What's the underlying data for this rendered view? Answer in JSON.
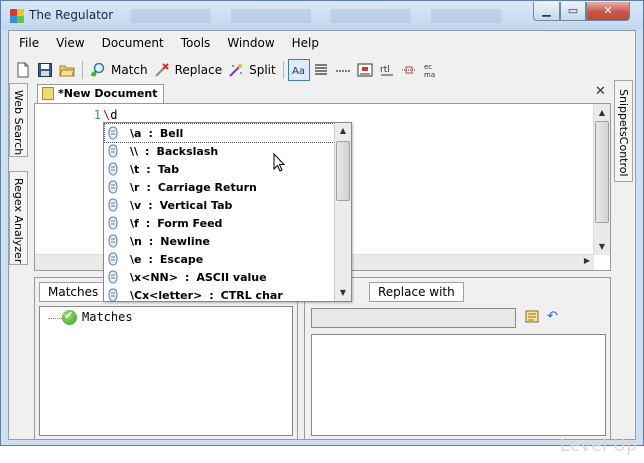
{
  "window": {
    "title": "The Regulator",
    "min": "▁",
    "max": "▭",
    "close": "✕"
  },
  "menu": [
    "File",
    "View",
    "Document",
    "Tools",
    "Window",
    "Help"
  ],
  "toolbar": {
    "match": "Match",
    "replace": "Replace",
    "split": "Split"
  },
  "left_tabs": {
    "web_search": "Web Search",
    "regex_analyzer": "Regex Analyzer"
  },
  "right_tab": "SnippetsControl",
  "document": {
    "tab_label": "*New Document",
    "line_number": "1",
    "code_bs": "\\",
    "code_rest": "d"
  },
  "autocomplete": [
    {
      "code": "\\a",
      "desc": "Bell"
    },
    {
      "code": "\\\\",
      "desc": "Backslash"
    },
    {
      "code": "\\t",
      "desc": "Tab"
    },
    {
      "code": "\\r",
      "desc": "Carriage Return"
    },
    {
      "code": "\\v",
      "desc": "Vertical Tab"
    },
    {
      "code": "\\f",
      "desc": "Form Feed"
    },
    {
      "code": "\\n",
      "desc": "Newline"
    },
    {
      "code": "\\e",
      "desc": "Escape"
    },
    {
      "code": "\\x<NN>",
      "desc": "ASCII value"
    },
    {
      "code": "\\Cx<letter>",
      "desc": "CTRL char"
    }
  ],
  "bottom_left": {
    "tab": "Matches",
    "tree_root": "Matches"
  },
  "bottom_right": {
    "tab": "Replace with"
  },
  "watermark": "Level Up",
  "colors": {
    "accent": "#3c7fb1",
    "match_green": "#2f9b1c",
    "line_number": "#2b91af"
  }
}
